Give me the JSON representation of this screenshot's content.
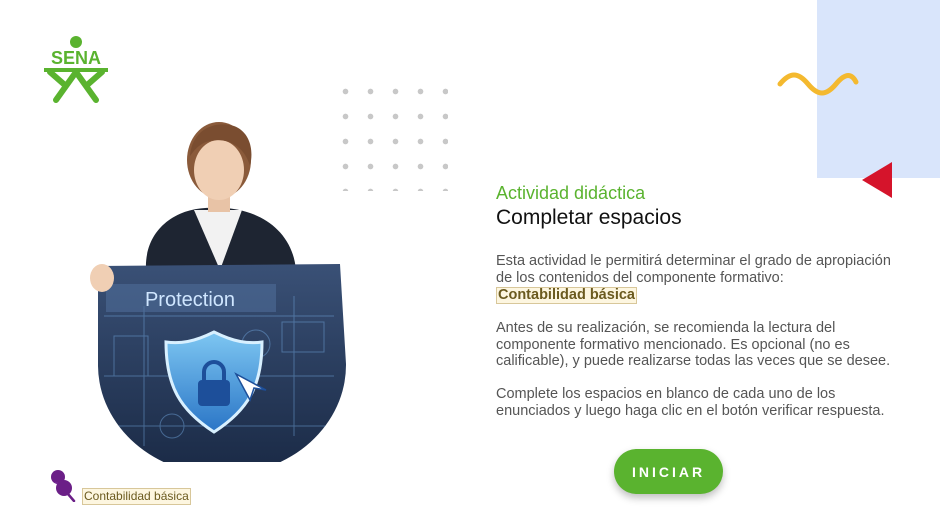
{
  "brand": {
    "logo_text": "SENA"
  },
  "hero": {
    "screen_label": "Protection"
  },
  "activity": {
    "kicker": "Actividad didáctica",
    "title": "Completar espacios",
    "intro": "Esta actividad le permitirá determinar el grado de apropiación de los contenidos del componente formativo:",
    "component_name": "Contabilidad básica",
    "recommendation": "Antes de su realización, se recomienda la lectura del componente formativo mencionado. Es opcional (no es calificable), y puede realizarse todas las veces que se desee.",
    "instructions": "Complete los espacios en blanco de cada uno de los enunciados y luego haga clic en el botón verificar respuesta."
  },
  "start_button": {
    "label": "INICIAR"
  },
  "footer": {
    "tag": "Contabilidad básica"
  },
  "colors": {
    "accent_green": "#5ab32f",
    "panel_blue": "#d9e5fb",
    "wave_yellow": "#f4b92f",
    "triangle_red": "#d5142b",
    "purple_pin": "#6b1f87"
  },
  "icons": [
    "sena-logo",
    "pushpin-icon",
    "shield-lock-icon",
    "wave-decoration",
    "triangle-decoration"
  ]
}
